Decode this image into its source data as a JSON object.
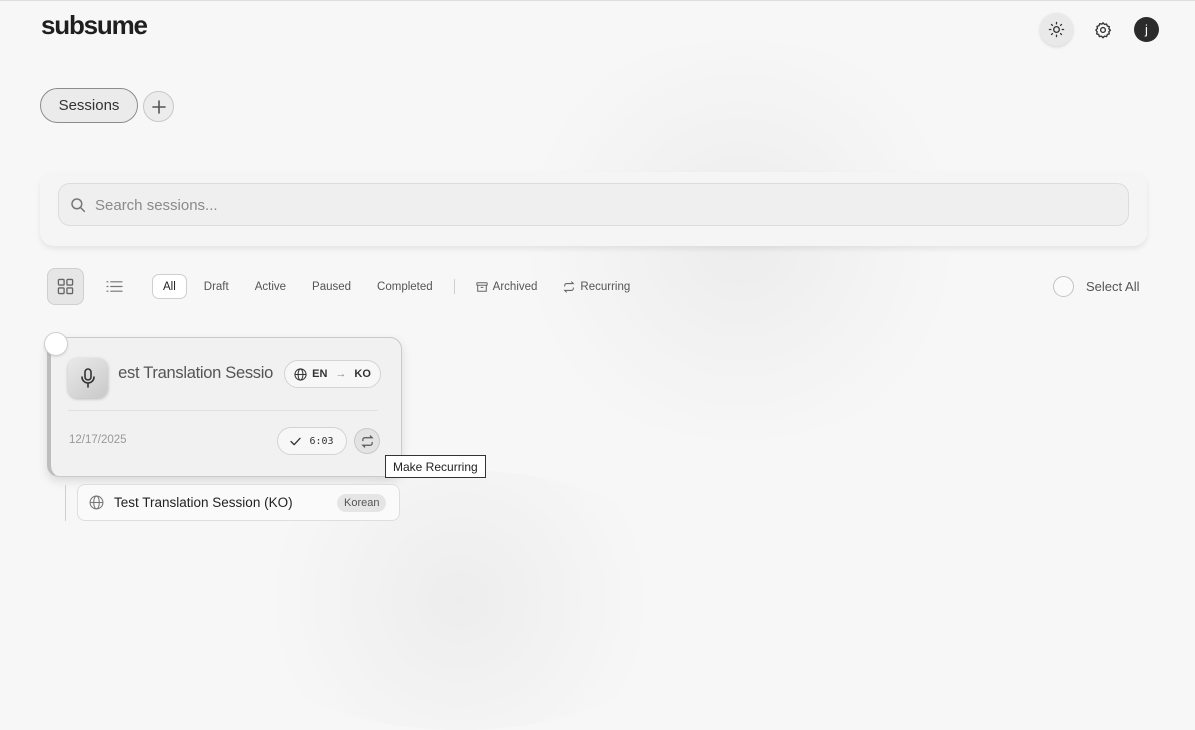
{
  "app": {
    "logo_text": "subsume"
  },
  "header": {
    "theme_icon": "sun-icon",
    "settings_icon": "gear-icon",
    "avatar_initial": "j"
  },
  "tabs": {
    "sessions_label": "Sessions",
    "add_icon": "plus-icon"
  },
  "search": {
    "placeholder": "Search sessions...",
    "value": ""
  },
  "view_toggle": {
    "grid_icon": "grid-icon",
    "list_icon": "list-icon",
    "selected": "grid"
  },
  "filters": {
    "all": "All",
    "draft": "Draft",
    "active": "Active",
    "paused": "Paused",
    "completed": "Completed",
    "archived": "Archived",
    "recurring": "Recurring",
    "selected": "All"
  },
  "select_all_label": "Select All",
  "session_card": {
    "title_visible": "est Translation Sessio",
    "source_lang": "EN",
    "target_lang": "KO",
    "date": "12/17/2025",
    "duration": "6:03",
    "recurring_icon": "repeat-icon"
  },
  "tooltip": "Make Recurring",
  "child_session": {
    "title": "Test Translation Session (KO)",
    "badge": "Korean"
  }
}
